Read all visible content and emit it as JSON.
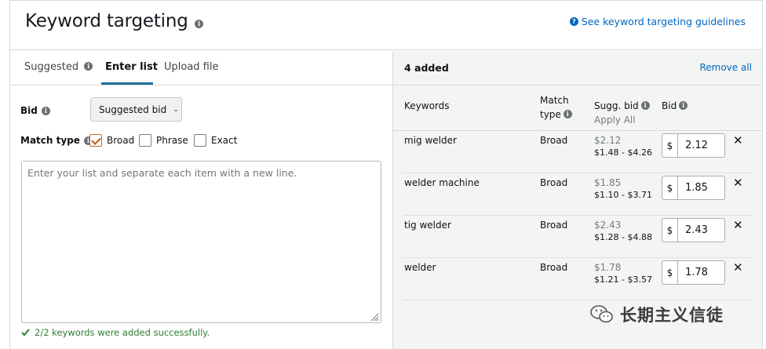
{
  "header": {
    "title": "Keyword targeting",
    "guidelines_link": "See keyword targeting guidelines"
  },
  "tabs": [
    {
      "label": "Suggested",
      "active": false
    },
    {
      "label": "Enter list",
      "active": true
    },
    {
      "label": "Upload file",
      "active": false
    }
  ],
  "bid": {
    "label": "Bid",
    "selected": "Suggested bid"
  },
  "match_type": {
    "label": "Match type",
    "options": [
      {
        "label": "Broad",
        "checked": true
      },
      {
        "label": "Phrase",
        "checked": false
      },
      {
        "label": "Exact",
        "checked": false
      }
    ]
  },
  "textarea": {
    "placeholder": "Enter your list and separate each item with a new line."
  },
  "success_message": "2/2 keywords were added successfully.",
  "added_panel": {
    "count_label": "4 added",
    "remove_all": "Remove all",
    "columns": {
      "keywords": "Keywords",
      "match_type_line1": "Match",
      "match_type_line2": "type",
      "sugg_bid": "Sugg. bid",
      "apply_all": "Apply All",
      "bid": "Bid"
    },
    "rows": [
      {
        "keyword": "mig welder",
        "match": "Broad",
        "sugg": "$2.12",
        "range": "$1.48 - $4.26",
        "currency": "$",
        "bid": "2.12"
      },
      {
        "keyword": "welder machine",
        "match": "Broad",
        "sugg": "$1.85",
        "range": "$1.10 - $3.71",
        "currency": "$",
        "bid": "1.85"
      },
      {
        "keyword": "tig welder",
        "match": "Broad",
        "sugg": "$2.43",
        "range": "$1.28 - $4.88",
        "currency": "$",
        "bid": "2.43"
      },
      {
        "keyword": "welder",
        "match": "Broad",
        "sugg": "$1.78",
        "range": "$1.21 - $3.57",
        "currency": "$",
        "bid": "1.78"
      }
    ]
  },
  "watermark": "长期主义信徒",
  "colors": {
    "link": "#0066c0",
    "tab_underline": "#1f6e9e",
    "success": "#2f7d32",
    "checkbox_accent": "#c05a1a"
  }
}
